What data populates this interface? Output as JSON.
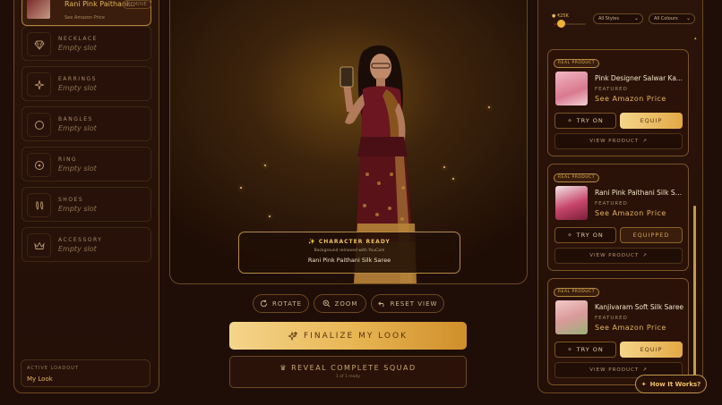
{
  "left_panel": {
    "equipped_item": {
      "name": "Rani Pink Paithani...",
      "sub": "See Amazon Price",
      "remove_label": "REMOVE"
    },
    "slots": [
      {
        "label": "NECKLACE",
        "value": "Empty slot",
        "icon": "necklace-icon"
      },
      {
        "label": "EARRINGS",
        "value": "Empty slot",
        "icon": "earrings-icon"
      },
      {
        "label": "BANGLES",
        "value": "Empty slot",
        "icon": "bangles-icon"
      },
      {
        "label": "RING",
        "value": "Empty slot",
        "icon": "ring-icon"
      },
      {
        "label": "SHOES",
        "value": "Empty slot",
        "icon": "shoes-icon"
      },
      {
        "label": "ACCESSORY",
        "value": "Empty slot",
        "icon": "crown-icon"
      }
    ],
    "loadout": {
      "title": "ACTIVE LOADOUT",
      "value": "My Look"
    }
  },
  "stage": {
    "character_card": {
      "title": "✨ CHARACTER READY",
      "subtitle": "Background removed with YouCam",
      "product": "Rani Pink Paithani Silk Saree"
    }
  },
  "controls": {
    "rotate": "ROTATE",
    "zoom": "ZOOM",
    "reset": "RESET VIEW",
    "finalize": "FINALIZE MY LOOK",
    "reveal": "REVEAL COMPLETE SQUAD",
    "reveal_sub": "1 of 1 ready"
  },
  "right_panel": {
    "price_filter": "₹25K",
    "price_fraction": 0.2,
    "styles_select": "All Styles",
    "colours_select": "All Colours",
    "products": [
      {
        "badge": "REAL PRODUCT",
        "name": "Pink Designer Salwar Ka...",
        "featured": "FEATURED",
        "price": "See Amazon Price",
        "try_on": "TRY ON",
        "equip": "EQUIP",
        "equipped": false,
        "view": "VIEW PRODUCT"
      },
      {
        "badge": "REAL PRODUCT",
        "name": "Rani Pink Paithani Silk Sar...",
        "featured": "FEATURED",
        "price": "See Amazon Price",
        "try_on": "TRY ON",
        "equip": "EQUIPPED",
        "equipped": true,
        "view": "VIEW PRODUCT"
      },
      {
        "badge": "REAL PRODUCT",
        "name": "Kanjivaram Soft Silk Saree",
        "featured": "FEATURED",
        "price": "See Amazon Price",
        "try_on": "TRY ON",
        "equip": "EQUIP",
        "equipped": false,
        "view": "VIEW PRODUCT"
      }
    ]
  },
  "help": {
    "how_it_works": "How It Works?"
  },
  "colors": {
    "gold": "#e3b55a",
    "background": "#1f0d07",
    "border": "#6a4a1f"
  }
}
